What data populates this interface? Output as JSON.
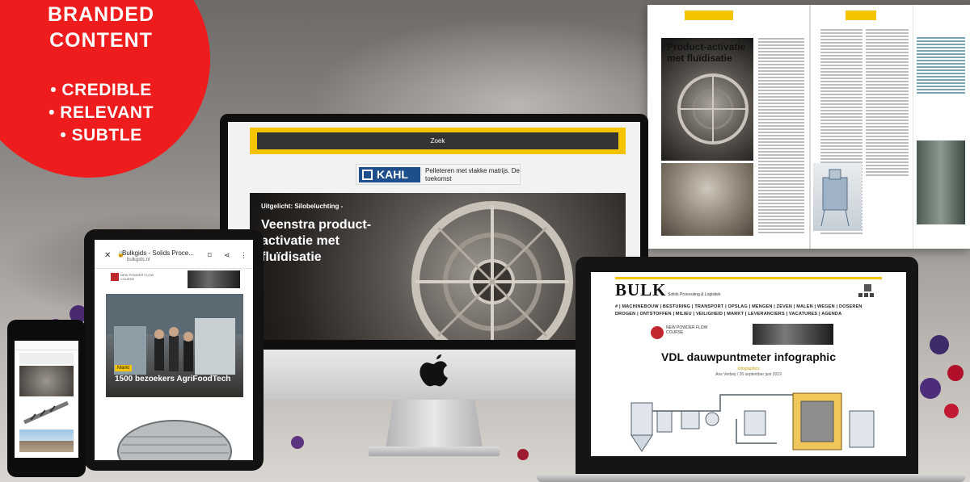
{
  "badge": {
    "heading_line1": "BRANDED",
    "heading_line2": "CONTENT",
    "bullet1": "• CREDIBLE",
    "bullet2": "• RELEVANT",
    "bullet3": "• SUBTLE",
    "color": "#ee1c1c"
  },
  "desktop": {
    "search_button": "Zoek",
    "ad_brand": "KAHL",
    "ad_text": "Pelleteren met vlakke matrijs. De toekomst",
    "hero_tag": "Uitgelicht: Silobeluchting -",
    "hero_title": "Veenstra product-activatie met fluïdisatie",
    "accent": "#f5c400"
  },
  "magazine": {
    "title_line1": "Product-activatie",
    "title_line2": "met fluïdisatie"
  },
  "tablet": {
    "tab_title": "Bulkgids - Solids Proce...",
    "tab_url": "bulkgids.nl",
    "ad_text": "NEW POWDER FLOW COURSE",
    "news_tag": "Markt",
    "news_caption": "1500 bezoekers AgriFoodTech"
  },
  "laptop": {
    "logo": "BULK",
    "tagline": "Solids Processing & Logistiek",
    "nav_row1": "#  |  MACHINEBOUW  |  BESTURING  |  TRANSPORT  |  OPSLAG  |  MENGEN  |  ZEVEN  |  MALEN  |  WEGEN  |  DOSEREN",
    "nav_row2": "DROGEN  |  ONTSTOFFEN  |  MILIEU  |  VEILIGHEID  |  MARKT  |  LEVERANCIERS  |  VACATURES  |  AGENDA",
    "ad_text": "NEW POWDER FLOW COURSE",
    "headline": "VDL dauwpuntmeter infographic",
    "meta_category": "Infographics",
    "meta_author": "Ans Verbeij  /  26 september juni 2019"
  }
}
